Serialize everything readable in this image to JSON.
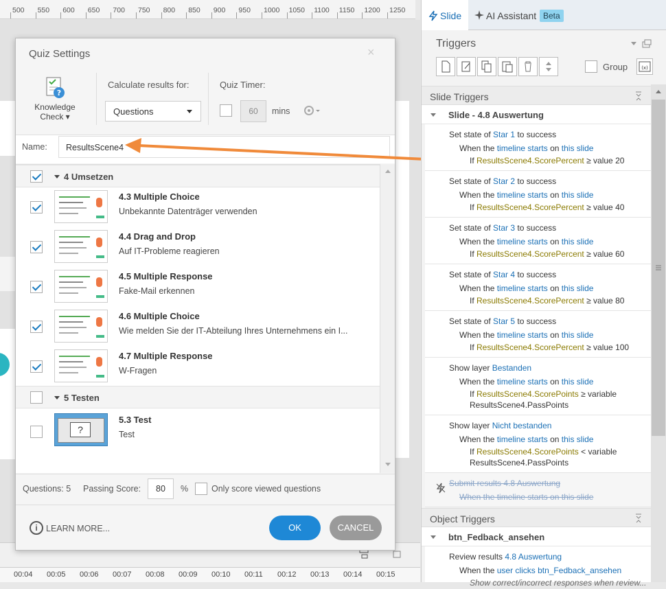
{
  "ruler": {
    "ticks": [
      "500",
      "550",
      "600",
      "650",
      "700",
      "750",
      "800",
      "850",
      "900",
      "950",
      "1000",
      "1050",
      "1100",
      "1150",
      "1200",
      "1250"
    ]
  },
  "timeline": {
    "ticks": [
      "00:04",
      "00:05",
      "00:06",
      "00:07",
      "00:08",
      "00:09",
      "00:10",
      "00:11",
      "00:12",
      "00:13",
      "00:14",
      "00:15"
    ]
  },
  "dialog": {
    "title": "Quiz Settings",
    "close": "×",
    "knowledge_check": "Knowledge Check ▾",
    "calc_label": "Calculate results for:",
    "calc_value": "Questions",
    "timer_label": "Quiz Timer:",
    "timer_value": "60",
    "timer_unit": "mins",
    "name_label": "Name:",
    "name_value": "ResultsScene4",
    "groups": [
      {
        "title": "4 Umsetzen",
        "checked": true
      },
      {
        "title": "5 Testen",
        "checked": false
      }
    ],
    "items": [
      {
        "title": "4.3 Multiple Choice",
        "subtitle": "Unbekannte Datenträger verwenden",
        "checked": true
      },
      {
        "title": "4.4 Drag and Drop",
        "subtitle": "Auf IT-Probleme reagieren",
        "checked": true
      },
      {
        "title": "4.5 Multiple Response",
        "subtitle": "Fake-Mail erkennen",
        "checked": true
      },
      {
        "title": "4.6 Multiple Choice",
        "subtitle": "Wie melden Sie der IT-Abteilung Ihres Unternehmens ein I...",
        "checked": true
      },
      {
        "title": "4.7 Multiple Response",
        "subtitle": "W-Fragen",
        "checked": true
      },
      {
        "title": "5.3 Test",
        "subtitle": "Test",
        "checked": false
      }
    ],
    "questions": "Questions: 5",
    "passing_label": "Passing Score:",
    "passing_value": "80",
    "percent": "%",
    "only_viewed": "Only score viewed questions",
    "learn_more": "LEARN MORE...",
    "ok": "OK",
    "cancel": "CANCEL"
  },
  "panel": {
    "tab_slide": "Slide",
    "tab_ai": "AI Assistant",
    "beta": "Beta",
    "triggers_title": "Triggers",
    "group_label": "Group",
    "slide_triggers": "Slide Triggers",
    "slide_name": "Slide - 4.8 Auswertung",
    "object_triggers": "Object Triggers",
    "object_name": "btn_Fedback_ansehen",
    "star_triggers": [
      {
        "star": "Star 1",
        "value": "value 20"
      },
      {
        "star": "Star 2",
        "value": "value 40"
      },
      {
        "star": "Star 3",
        "value": "value 60"
      },
      {
        "star": "Star 4",
        "value": "value 80"
      },
      {
        "star": "Star 5",
        "value": "value 100"
      }
    ],
    "layer_triggers": [
      {
        "layer": "Bestanden",
        "op": "≥ variable"
      },
      {
        "layer": "Nicht bestanden",
        "op": "< variable"
      }
    ],
    "w": {
      "set_state_of": "Set state of",
      "to": "to",
      "success": "success",
      "when_the": "When the",
      "timeline_starts": "timeline starts",
      "on": "on",
      "this_slide": "this slide",
      "if": "If",
      "score_percent": "ResultsScene4.ScorePercent",
      "gte": "≥",
      "show_layer": "Show layer",
      "score_points": "ResultsScene4.ScorePoints",
      "pass_points": "ResultsScene4.PassPoints",
      "submit": "Submit results 4.8 Auswertung",
      "submit_when": "When the timeline starts on this slide",
      "review_results": "Review results",
      "review_target": "4.8 Auswertung",
      "user_clicks": "user clicks",
      "btn": "btn_Fedback_ansehen",
      "show_correct": "Show correct/incorrect responses when review..."
    }
  }
}
